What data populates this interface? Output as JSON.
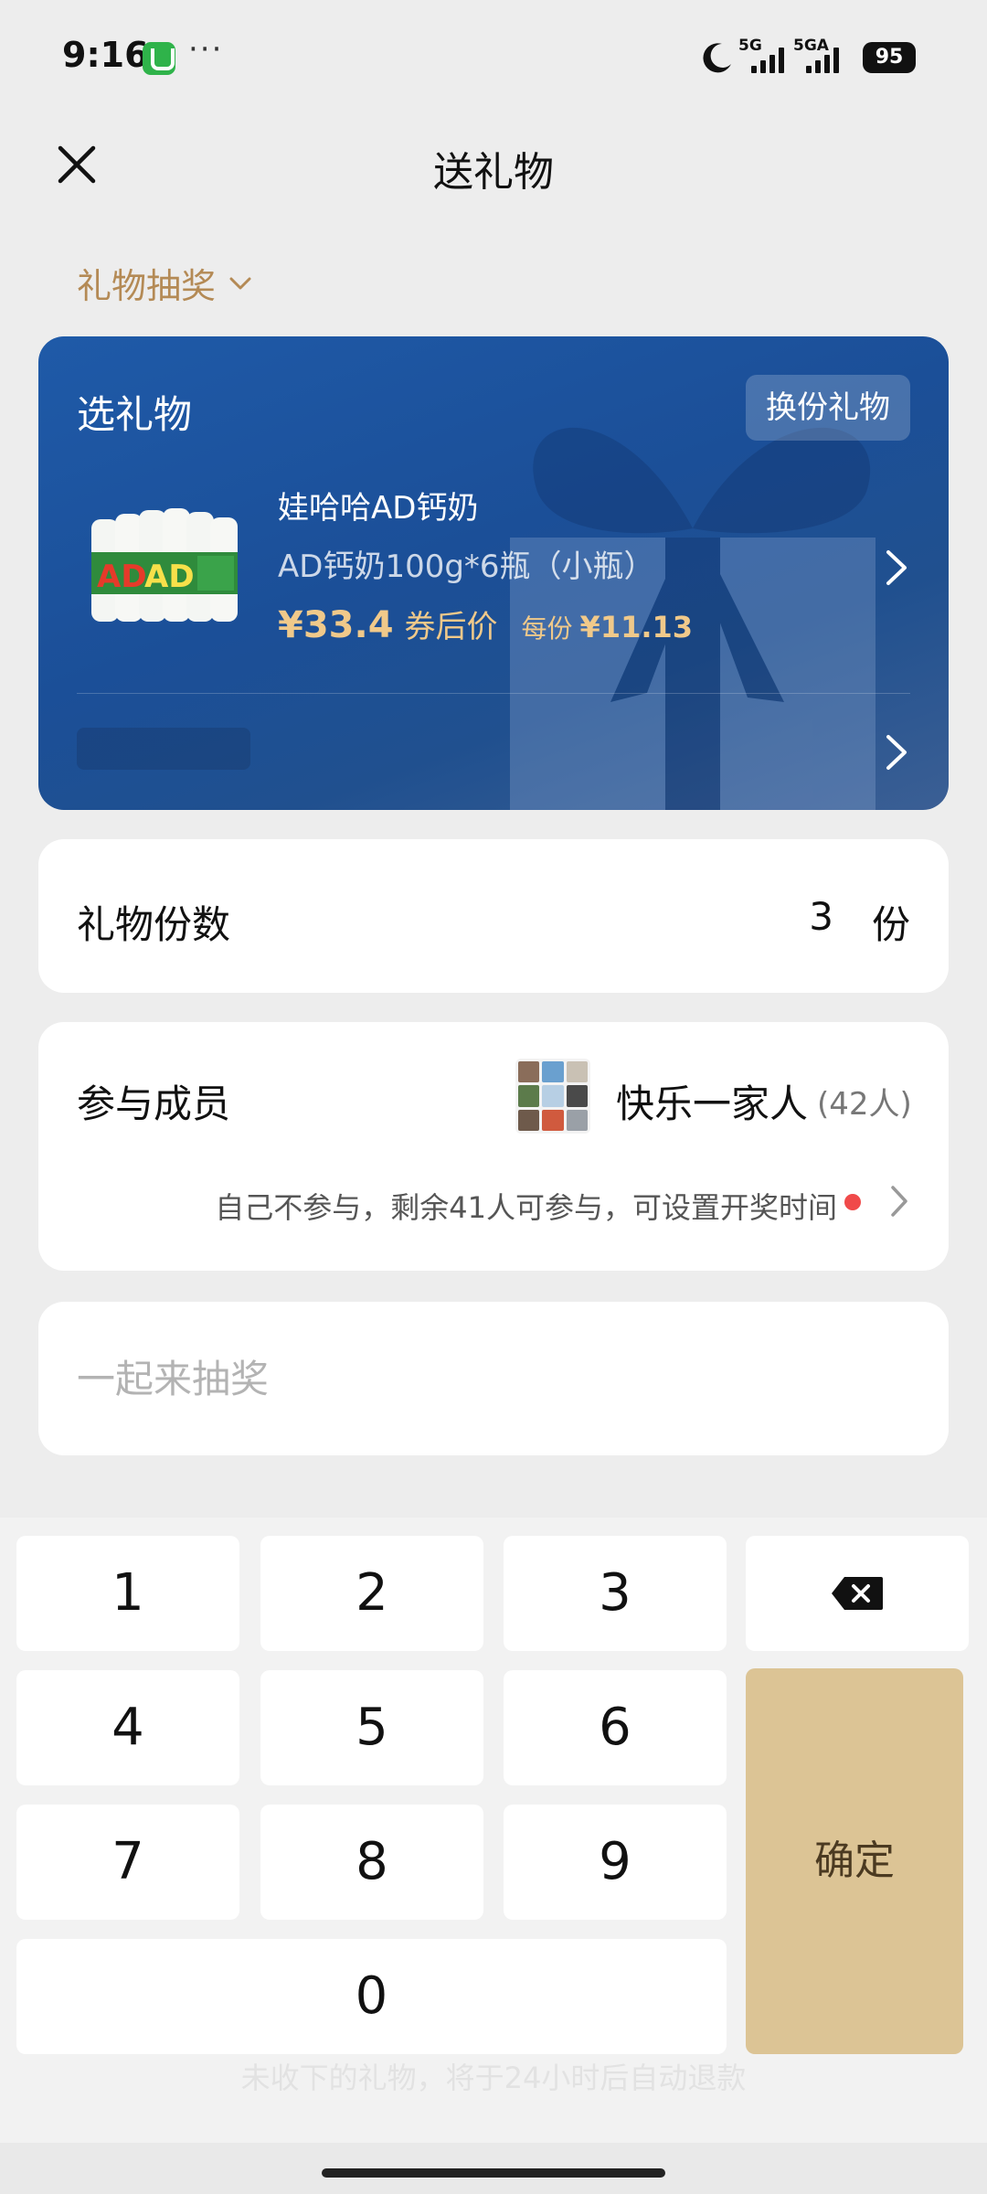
{
  "status_bar": {
    "time": "9:16",
    "dots": "···",
    "network1": "5G",
    "network2": "5GA",
    "battery": "95"
  },
  "header": {
    "title": "送礼物"
  },
  "mode": {
    "label": "礼物抽奖"
  },
  "gift_card": {
    "title": "选礼物",
    "change_button": "换份礼物",
    "product_name": "娃哈哈AD钙奶",
    "product_spec": "AD钙奶100g*6瓶（小瓶）",
    "price": "¥33.4",
    "price_label": "券后价",
    "per_label": "每份",
    "per_price": "¥11.13"
  },
  "quantity": {
    "label": "礼物份数",
    "value": "3",
    "unit": "份"
  },
  "members": {
    "label": "参与成员",
    "group_name": "快乐一家人",
    "group_count": "(42人)",
    "note": "自己不参与，剩余41人可参与，可设置开奖时间"
  },
  "message": {
    "placeholder": "一起来抽奖"
  },
  "keypad": {
    "keys": [
      "1",
      "2",
      "3",
      "4",
      "5",
      "6",
      "7",
      "8",
      "9",
      "0"
    ],
    "confirm": "确定"
  },
  "footer": {
    "refund_note": "未收下的礼物，将于24小时后自动退款"
  },
  "colors": {
    "accent_gold": "#b48a55",
    "card_blue": "#1f5aa8",
    "price_gold": "#f0c98a",
    "confirm_bg": "#dcc495",
    "dot_red": "#f04a4a"
  }
}
